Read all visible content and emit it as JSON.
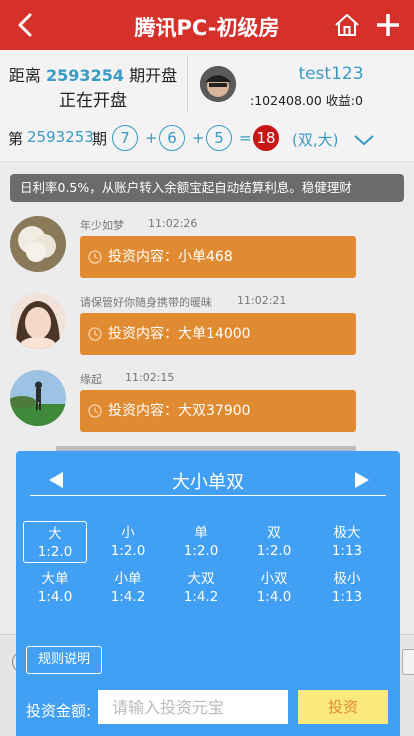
{
  "header": {
    "title": "腾讯PC-初级房"
  },
  "period": {
    "prefix": "距离",
    "number": "2593254",
    "suffix": "期开盘",
    "status": "正在开盘"
  },
  "user": {
    "name": "test123",
    "money_line": ":102408.00 收益:0"
  },
  "last_result": {
    "prefix": "第",
    "number": "2593253",
    "suffix": "期",
    "balls": [
      "7",
      "6",
      "5"
    ],
    "plus": "+",
    "equals": "=",
    "sum": "18",
    "type": "(双,大)"
  },
  "notice": "日利率0.5%，从账户转入余额宝起自动结算利息。稳健理财",
  "messages": [
    {
      "name": "年少如梦",
      "time": "11:02:26",
      "content": "投资内容：小单468"
    },
    {
      "name": "请保管好你随身携带的暖昧",
      "time": "11:02:21",
      "content": "投资内容：大单14000"
    },
    {
      "name": "缘起",
      "time": "11:02:15",
      "content": "投资内容：大双37900"
    }
  ],
  "panel": {
    "title": "大小单双",
    "options": [
      {
        "name": "大",
        "odds": "1:2.0",
        "selected": true
      },
      {
        "name": "小",
        "odds": "1:2.0"
      },
      {
        "name": "单",
        "odds": "1:2.0"
      },
      {
        "name": "双",
        "odds": "1:2.0"
      },
      {
        "name": "极大",
        "odds": "1:13"
      },
      {
        "name": "大单",
        "odds": "1:4.0"
      },
      {
        "name": "小单",
        "odds": "1:4.2"
      },
      {
        "name": "大双",
        "odds": "1:4.2"
      },
      {
        "name": "小双",
        "odds": "1:4.0"
      },
      {
        "name": "极小",
        "odds": "1:13"
      }
    ],
    "rule_label": "规则说明",
    "amount_label": "投资金额:",
    "amount_placeholder": "请输入投资元宝",
    "invest_label": "投资"
  },
  "colors": {
    "header": "#d6302a",
    "accent_blue": "#3a9bc4",
    "panel": "#42a0f4",
    "bubble": "#e08b32",
    "sum_ball": "#c81616",
    "invest_button": "#fbe97a"
  },
  "icons": {
    "back": "back-arrow-icon",
    "home": "home-icon",
    "add": "plus-icon",
    "expand": "chevron-down-icon",
    "clock": "clock-icon",
    "prev": "triangle-left-icon",
    "next": "triangle-right-icon"
  }
}
